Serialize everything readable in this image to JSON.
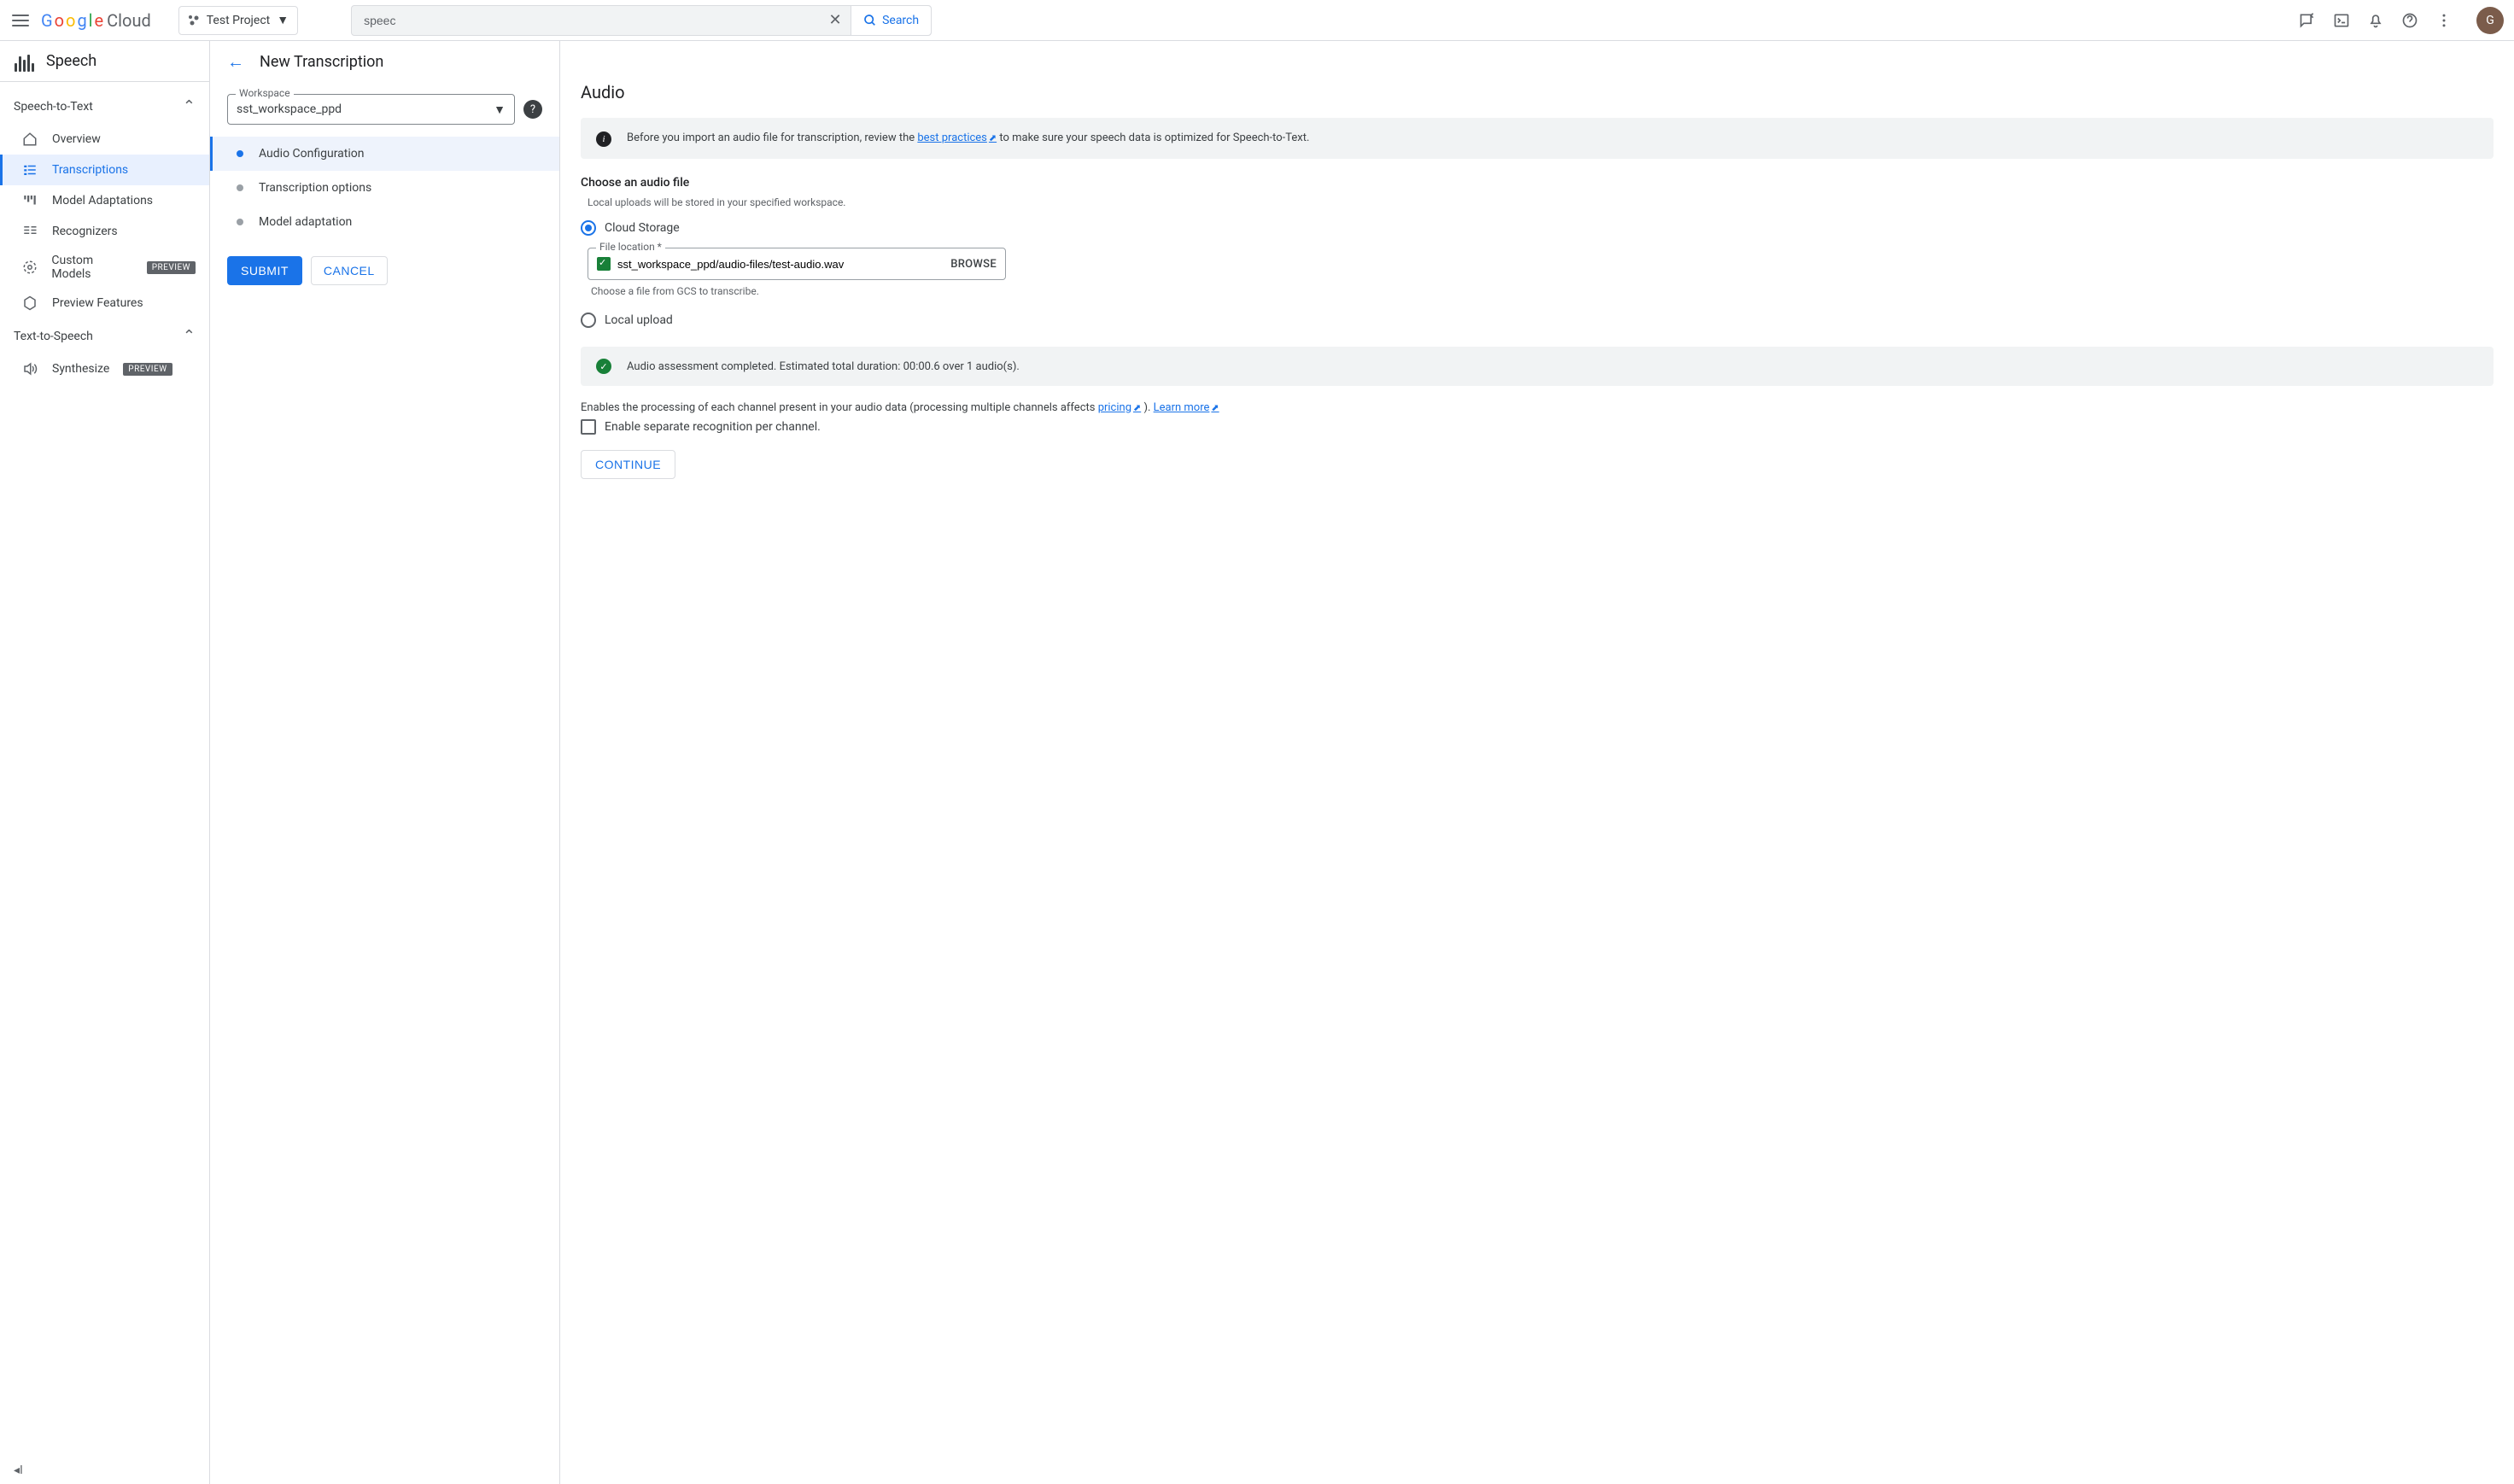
{
  "header": {
    "logo_cloud": "Cloud",
    "project_name": "Test Project",
    "search_value": "speec",
    "search_button": "Search",
    "avatar_letter": "G"
  },
  "sidebar": {
    "product_title": "Speech",
    "group_stt": "Speech-to-Text",
    "items_stt": [
      {
        "label": "Overview"
      },
      {
        "label": "Transcriptions"
      },
      {
        "label": "Model Adaptations"
      },
      {
        "label": "Recognizers"
      },
      {
        "label": "Custom Models",
        "badge": "PREVIEW"
      },
      {
        "label": "Preview Features"
      }
    ],
    "group_tts": "Text-to-Speech",
    "items_tts": [
      {
        "label": "Synthesize",
        "badge": "PREVIEW"
      }
    ]
  },
  "middle": {
    "page_title": "New Transcription",
    "workspace_label": "Workspace",
    "workspace_value": "sst_workspace_ppd",
    "steps": [
      {
        "label": "Audio Configuration"
      },
      {
        "label": "Transcription options"
      },
      {
        "label": "Model adaptation"
      }
    ],
    "submit": "SUBMIT",
    "cancel": "CANCEL"
  },
  "main": {
    "heading": "Audio",
    "info_pre": "Before you import an audio file for transcription, review the ",
    "info_link": "best practices",
    "info_post": " to make sure your speech data is optimized for Speech-to-Text.",
    "choose_title": "Choose an audio file",
    "upload_hint": "Local uploads will be stored in your specified workspace.",
    "radio_cloud": "Cloud Storage",
    "radio_local": "Local upload",
    "file_label": "File location *",
    "file_value": "sst_workspace_ppd/audio-files/test-audio.wav",
    "browse": "BROWSE",
    "file_helper": "Choose a file from GCS to transcribe.",
    "success": "Audio assessment completed. Estimated total duration: 00:00.6 over 1 audio(s).",
    "channels_pre": "Enables the processing of each channel present in your audio data (processing multiple channels affects ",
    "channels_link1": "pricing",
    "channels_mid": " ). ",
    "channels_link2": "Learn more",
    "checkbox_label": "Enable separate recognition per channel.",
    "continue": "CONTINUE"
  }
}
